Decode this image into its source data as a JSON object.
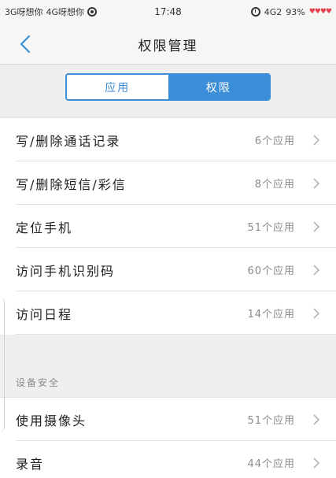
{
  "statusbar": {
    "carrier1": "3G呀想你",
    "carrier2": "4G呀想你",
    "time": "17:48",
    "network": "4G2",
    "battery": "93%",
    "hearts": "♥♥♥♥"
  },
  "header": {
    "title": "权限管理"
  },
  "tabs": {
    "apps": "应用",
    "permissions": "权限"
  },
  "permissions": [
    {
      "label": "写/删除通话记录",
      "count": "6个应用"
    },
    {
      "label": "写/删除短信/彩信",
      "count": "8个应用"
    },
    {
      "label": "定位手机",
      "count": "51个应用"
    },
    {
      "label": "访问手机识别码",
      "count": "60个应用"
    },
    {
      "label": "访问日程",
      "count": "14个应用"
    }
  ],
  "device_security": {
    "header": "设备安全",
    "items": [
      {
        "label": "使用摄像头",
        "count": "51个应用"
      },
      {
        "label": "录音",
        "count": "44个应用"
      }
    ]
  },
  "colors": {
    "accent": "#3d8ed8",
    "background": "#f0efed"
  }
}
